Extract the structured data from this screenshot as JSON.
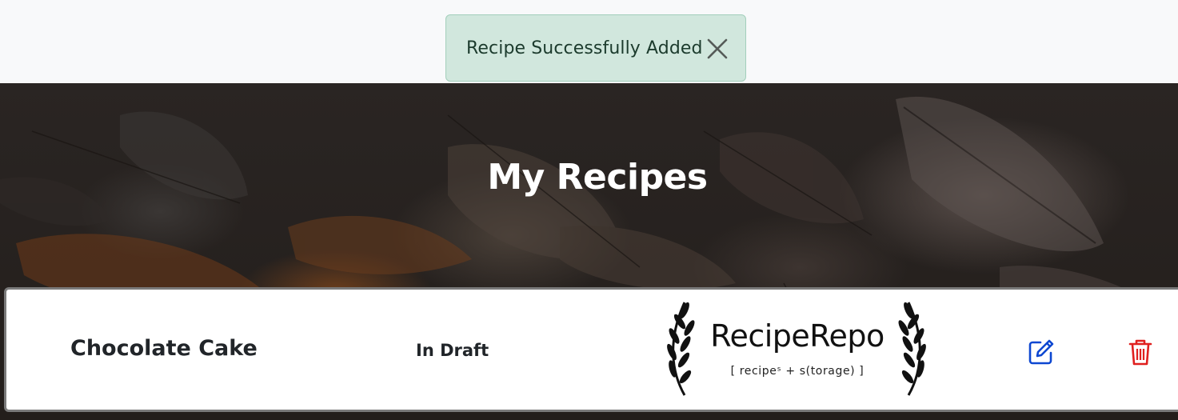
{
  "toast": {
    "message": "Recipe Successfully Added",
    "close_icon": "close-icon",
    "background": "#d1e7dd"
  },
  "hero": {
    "title": "My Recipes"
  },
  "recipe_card": {
    "name": "Chocolate Cake",
    "status": "In Draft",
    "logo": {
      "title": "RecipeRepo",
      "subtitle": "[ recipeˢ + s(torage) ]"
    },
    "edit_icon": "pencil-square-icon",
    "delete_icon": "trash-icon",
    "edit_color": "#0d47d1",
    "delete_color": "#e0201f"
  }
}
